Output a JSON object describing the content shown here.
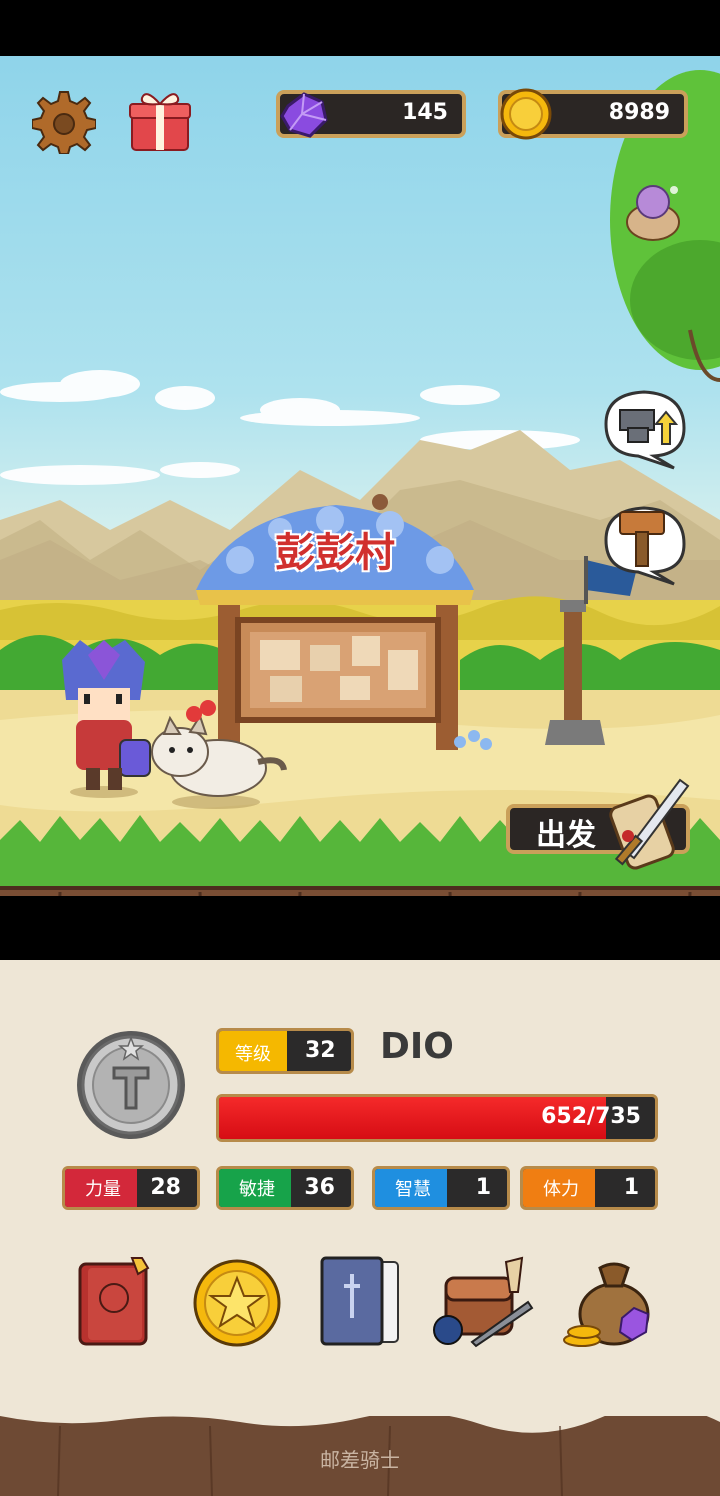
{
  "currency": {
    "gems": "145",
    "gold": "8989"
  },
  "village": {
    "name": "彭彭村"
  },
  "depart_label": "出发",
  "player": {
    "level_label": "等级",
    "level": "32",
    "name": "DIO",
    "hp_text": "652/735",
    "hp_fraction": 0.887
  },
  "stats": [
    {
      "label": "力量",
      "value": "28",
      "color": "#d3283a"
    },
    {
      "label": "敏捷",
      "value": "36",
      "color": "#17a34a"
    },
    {
      "label": "智慧",
      "value": "1",
      "color": "#1f8fe0"
    },
    {
      "label": "体力",
      "value": "1",
      "color": "#f07e12"
    }
  ],
  "menu_icons": [
    "book-icon",
    "star-coin-icon",
    "card-deck-icon",
    "inventory-bag-icon",
    "treasure-sack-icon"
  ],
  "footer_caption": "邮差骑士",
  "colors": {
    "hud_border": "#caa05a",
    "hp_red": "#e3111b",
    "level_yellow": "#f5b800",
    "panel_bg": "#eee6d6"
  }
}
